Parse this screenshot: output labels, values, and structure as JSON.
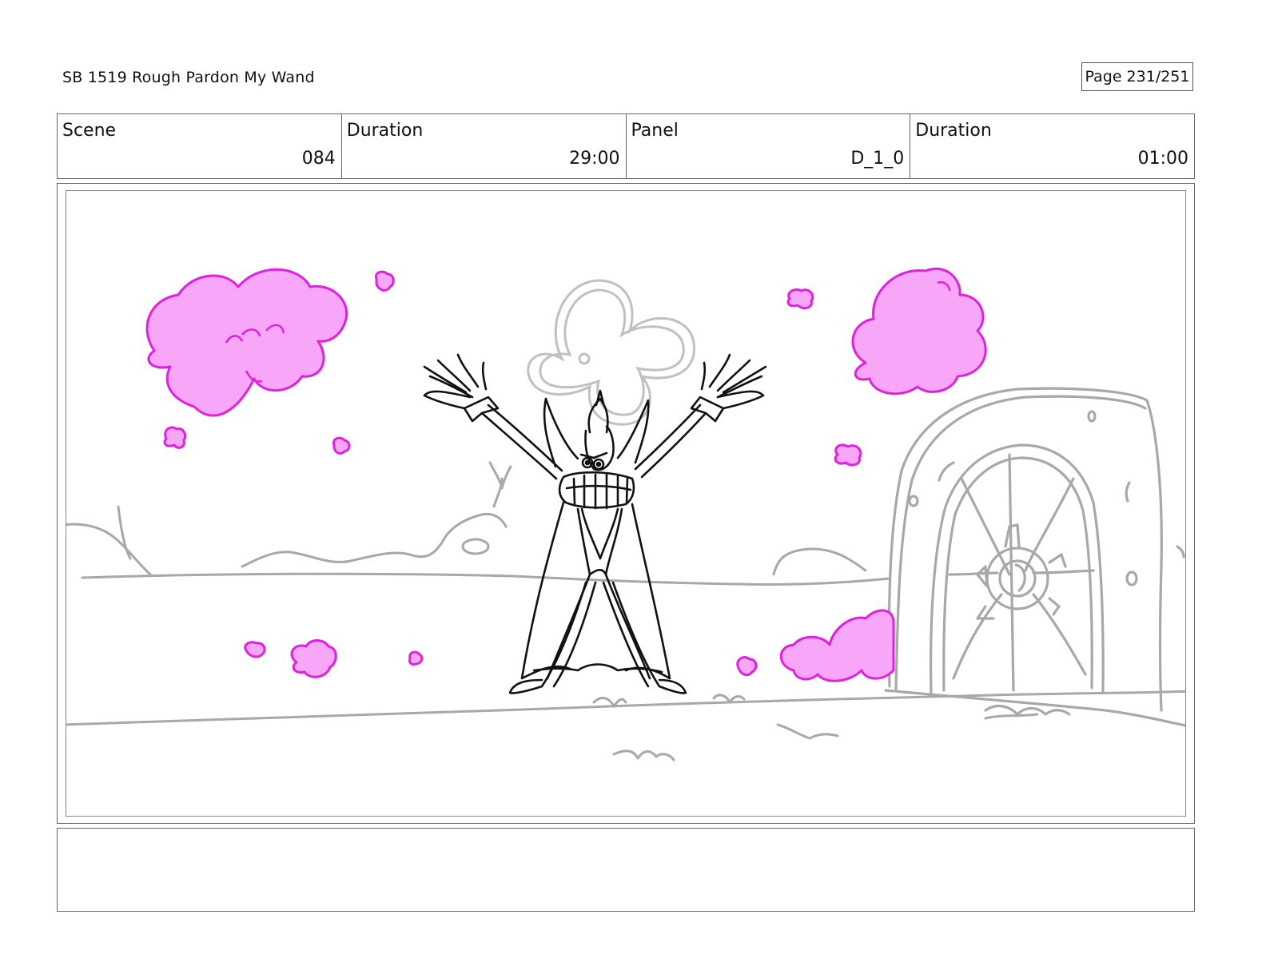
{
  "header": {
    "title": "SB 1519 Rough  Pardon My Wand",
    "page": "Page 231/251"
  },
  "info": {
    "scene_label": "Scene",
    "scene_value": "084",
    "scene_duration_label": "Duration",
    "scene_duration_value": "29:00",
    "panel_label": "Panel",
    "panel_value": "D_1_0",
    "panel_duration_label": "Duration",
    "panel_duration_value": "01:00"
  },
  "notes": {
    "text": ""
  },
  "colors": {
    "cloud_fill": "#f7a6f8",
    "cloud_stroke": "#e020e0",
    "sketch_gray": "#a8a8a8",
    "ink": "#111111"
  }
}
